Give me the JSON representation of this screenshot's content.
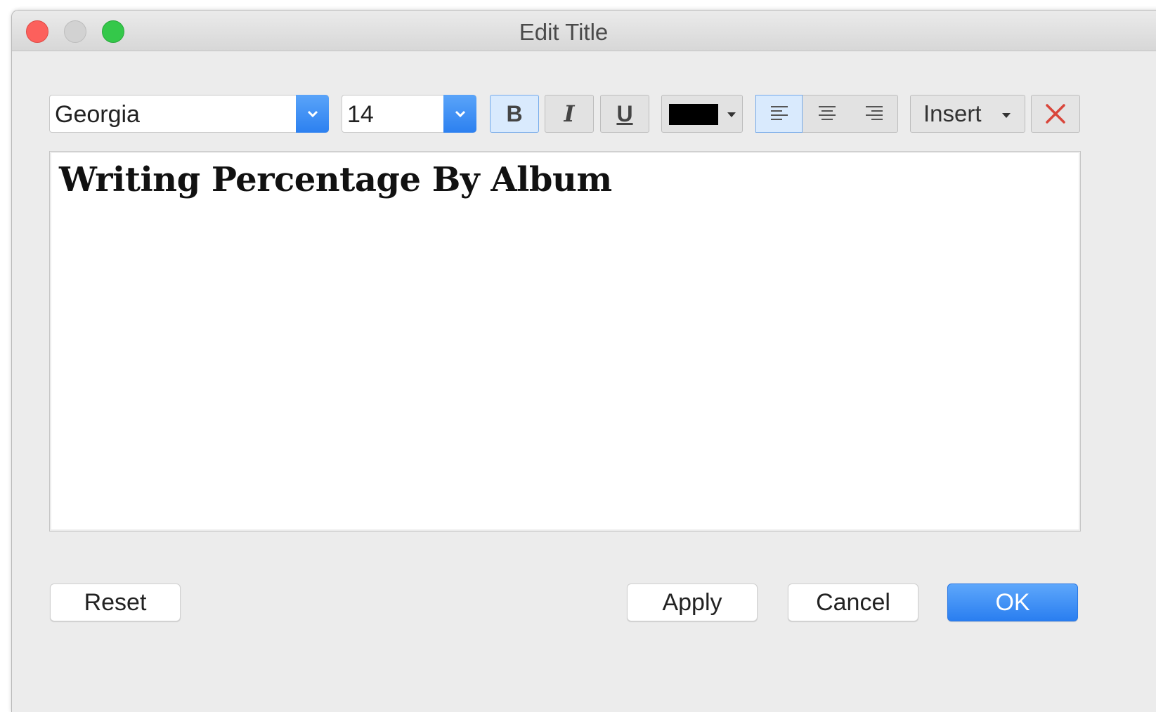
{
  "window": {
    "title": "Edit Title"
  },
  "toolbar": {
    "font_family": "Georgia",
    "font_size": "14",
    "bold_label": "B",
    "italic_label": "I",
    "underline_label": "U",
    "text_color": "#000000",
    "bold_active": true,
    "alignment": "left",
    "insert_label": "Insert",
    "clear_icon": "close-x-icon"
  },
  "editor": {
    "text": "Writing Percentage By Album"
  },
  "footer": {
    "reset_label": "Reset",
    "apply_label": "Apply",
    "cancel_label": "Cancel",
    "ok_label": "OK"
  },
  "colors": {
    "accent": "#2c80f0",
    "clear_icon": "#d9463b"
  }
}
